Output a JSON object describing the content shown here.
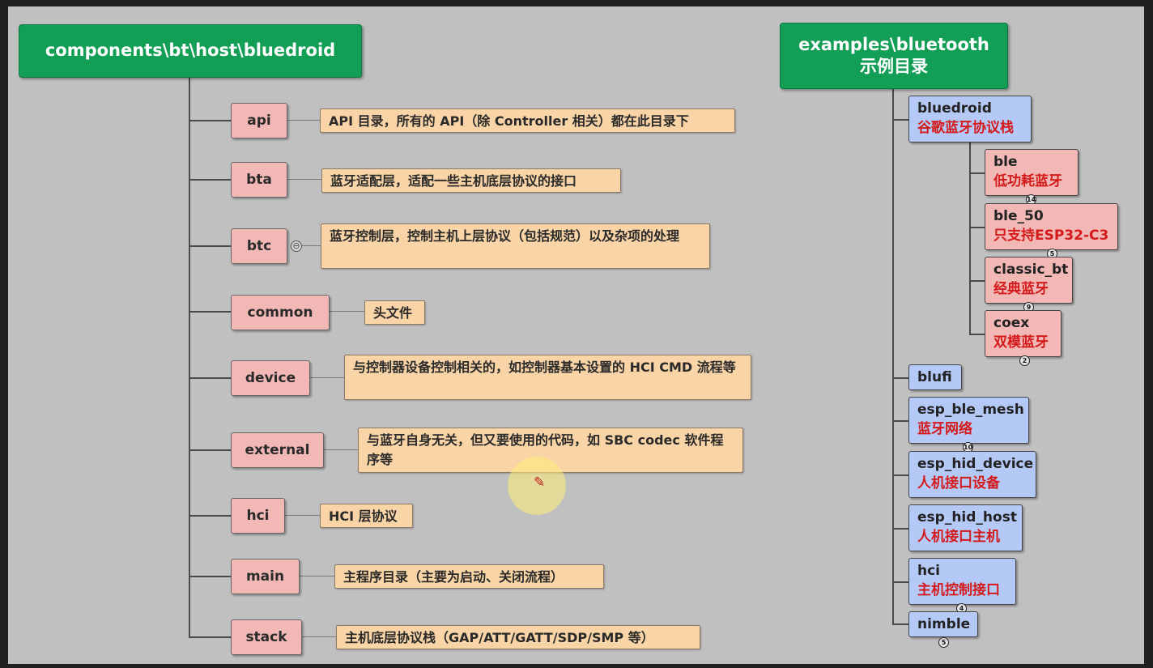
{
  "left_tree": {
    "root": "components\\bt\\host\\bluedroid",
    "items": [
      {
        "name": "api",
        "desc": "API 目录，所有的 API（除 Controller 相关）都在此目录下"
      },
      {
        "name": "bta",
        "desc": "蓝牙适配层，适配一些主机底层协议的接口"
      },
      {
        "name": "btc",
        "desc": "蓝牙控制层，控制主机上层协议（包括规范）以及杂项的处理",
        "collapse_glyph": "⊖"
      },
      {
        "name": "common",
        "desc": "头文件"
      },
      {
        "name": "device",
        "desc": "与控制器设备控制相关的，如控制器基本设置的 HCI CMD 流程等"
      },
      {
        "name": "external",
        "desc": "与蓝牙自身无关，但又要使用的代码，如 SBC codec 软件程序等"
      },
      {
        "name": "hci",
        "desc": "HCI 层协议"
      },
      {
        "name": "main",
        "desc": "主程序目录（主要为启动、关闭流程）"
      },
      {
        "name": "stack",
        "desc": "主机底层协议栈（GAP/ATT/GATT/SDP/SMP 等）"
      }
    ]
  },
  "right_tree": {
    "root_line1": "examples\\bluetooth",
    "root_line2": "示例目录",
    "bluedroid": {
      "name": "bluedroid",
      "label": "谷歌蓝牙协议栈"
    },
    "bluedroid_children": [
      {
        "name": "ble",
        "label": "低功耗蓝牙",
        "count": "14"
      },
      {
        "name": "ble_50",
        "label": "只支持ESP32-C3",
        "count": "5"
      },
      {
        "name": "classic_bt",
        "label": "经典蓝牙",
        "count": "9"
      },
      {
        "name": "coex",
        "label": "双模蓝牙",
        "count": "2"
      }
    ],
    "items": [
      {
        "name": "blufi",
        "label": "",
        "count": ""
      },
      {
        "name": "esp_ble_mesh",
        "label": "蓝牙网络",
        "count": "10"
      },
      {
        "name": "esp_hid_device",
        "label": "人机接口设备",
        "count": ""
      },
      {
        "name": "esp_hid_host",
        "label": "人机接口主机",
        "count": ""
      },
      {
        "name": "hci",
        "label": "主机控制接口",
        "count": "4"
      },
      {
        "name": "nimble",
        "label": "",
        "count": "5"
      }
    ]
  },
  "cursor_icon": "pencil-cursor-icon",
  "colors": {
    "root_green": "#129e55",
    "folder_pink": "#f1b8b5",
    "desc_orange": "#f9d4a6",
    "node_blue": "#b5c9f7",
    "label_red": "#d41a1a",
    "background": "#c0c0c0"
  }
}
